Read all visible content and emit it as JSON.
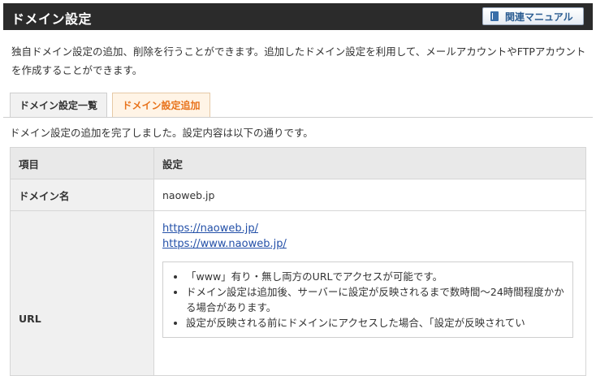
{
  "header": {
    "title": "ドメイン設定",
    "manual_button": "関連マニュアル"
  },
  "description": "独自ドメイン設定の追加、削除を行うことができます。追加したドメイン設定を利用して、メールアカウントやFTPアカウントを作成することができます。",
  "tabs": [
    {
      "label": "ドメイン設定一覧",
      "active": false
    },
    {
      "label": "ドメイン設定追加",
      "active": true
    }
  ],
  "completion_message": "ドメイン設定の追加を完了しました。設定内容は以下の通りです。",
  "table": {
    "headers": [
      "項目",
      "設定"
    ],
    "domain": {
      "label": "ドメイン名",
      "value": "naoweb.jp"
    },
    "url": {
      "label": "URL",
      "links": [
        "https://naoweb.jp/",
        "https://www.naoweb.jp/"
      ],
      "notes": [
        "「www」有り・無し両方のURLでアクセスが可能です。",
        "ドメイン設定は追加後、サーバーに設定が反映されるまで数時間〜24時間程度かかる場合があります。",
        "設定が反映される前にドメインにアクセスした場合、「設定が反映されてい"
      ]
    }
  }
}
